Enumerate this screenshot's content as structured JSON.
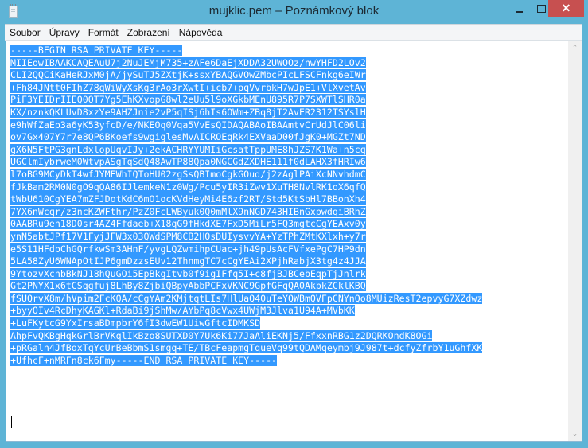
{
  "window": {
    "title": "mujklic.pem – Poznámkový blok",
    "icon": "notepad-icon",
    "controls": {
      "minimize": "minimize-icon",
      "maximize": "maximize-icon",
      "close": "✕"
    }
  },
  "menu": {
    "items": [
      {
        "label": "Soubor"
      },
      {
        "label": "Úpravy"
      },
      {
        "label": "Formát"
      },
      {
        "label": "Zobrazení"
      },
      {
        "label": "Nápověda"
      }
    ]
  },
  "editor": {
    "selection_color": "#3399ff",
    "lines": [
      "-----BEGIN RSA PRIVATE KEY-----",
      "MIIEowIBAAKCAQEAuU7j2NuJEMjM735+zAFe6DaEjXDDA32UWOOz/nwYHFD2LOv2",
      "CLI2QQCiKaHeRJxM0jA/jySuTJ5ZXtjK+ssxYBAQGVOwZMbcPIcLFSCFnkg6eIWr",
      "+Fh84JNtt0FIhZ78qWiWyXsKg3rAo3rXwtI+icb7+pqVvrbkH7wJpE1+VlXvetAv",
      "PiF3YEIDrIIEQ0QT7Yg5EhKXvopG8wl2eUu5l9oXGkbMEnU895R7P7SXWTlSHR0a",
      "KX/nznkQKLUvD8xzYe9AHZJnie2vP5qISj6hIs6OWm+ZBq8jT2AvER2312TSYslH",
      "e9hWfZaEp3a6yK53yfcD/e/NKEOq0Vqa5VvEsQIDAQABAoIBAAmtvCrUdJlC06li",
      "ov7Gx407Y7r7e8QP6BKoefs9wgiglesMvAICROEqRk4EXVaaD00fJgK0+MGZt7ND",
      "gX6N5FtPG3gnLdxlopUqvIJy+2ekACHRYYUMIiGcsatTppUME8hJZS7K1Wa+n5cq",
      "UGClmIybrweM0WtvpASgTqSdQ48AwTP88Qpa0NGCGdZXDHE111f0dLAHX3fHRIw6",
      "l7oBG9MCyDkT4wfJYMEWhIQToHU02zgSsQBImoCgkGOud/j2zAglPAiXcNNvhdmC",
      "fJkBam2RM0N0gO9qQA86IJlemkeN1z0Wg/Pcu5yIR3iZwv1XuTH8NvlRK1oX6qfQ",
      "tWbU610CgYEA7mZFJDotKdC6mO1ocKVdHeyMi4E6zf2RT/Std5KtSbHl7BBonXh4",
      "7YX6nWcqr/z3ncKZWFthr/PzZ0FcLWByuk0Q0mMlX9nNGD743HIBnGxpwdqiBRhZ",
      "0AABRu9eh18D0sr4AZ4Ffdaeb+X18qG9fHkdXE7FxD5MiLr5FQ3mgtcCgYEAxv0y",
      "ynN5abtJPf17V1FyjJFW3x03QWdSPM8CB2HOsDUIysvvYA+YzTPhZMtKXlxh+y7r",
      "e5S11HFdbChGQrfkwSm3AHnF/yvgLQZwmihpCUac+jh49pUsAcFVfxePgC7HP9dn",
      "5LA58ZyU6WNApOtIJP6gmDzzsEUv12ThnmgTC7cCgYEAi2XPjhRabjX3tg4z4JJA",
      "9YtozvXcnbBkNJ18hQuGOi5EpBkgItvb0f9igIFfq5I+c8fjBJBCebEqpTjJnlrk",
      "Gt2PNYX1x6tCSqgfuj8LhBy8ZjbiQBpyAbbPCFxVKNC9GpfGFqQA0AkbkZCklKBQ",
      "fSUQrvX8m/hVpim2FcKQA/cCgYAm2KMjtqtLIs7HlUaQ40uTeYQWBmQVFpCNYnQo8MUizResT2epvyG7XZdwz",
      "+byyOIv4RcDhyKAGKl+RdaBi9jShMw/AYbPq8cVwx4UWjM3Jlva1U94A+MVbKK",
      "+LuFKytcG9YxIrsaBDmpbrY6fI3dwEW1UiwGftcIDMKSD",
      "AhpFvQKBgHqkGrlBrVKqlIkBzo8SUTXD0Y7Uk6Ki77JaAliEKNj5/FfxxnRBG1z2DQRKOndK8OGi",
      "+pRGaln4JfBoxTqYcUrBeBbmS1smgq+TE/TBcFeapmgTqueVq99tQDAMqeymbj9J987t+dcfyZfrbY1uGhfXK",
      "+UfhcF+nMRFn8ck6Fmy-----END RSA PRIVATE KEY-----"
    ]
  },
  "scrollbar": {
    "up": "⌃",
    "down": "⌄"
  }
}
